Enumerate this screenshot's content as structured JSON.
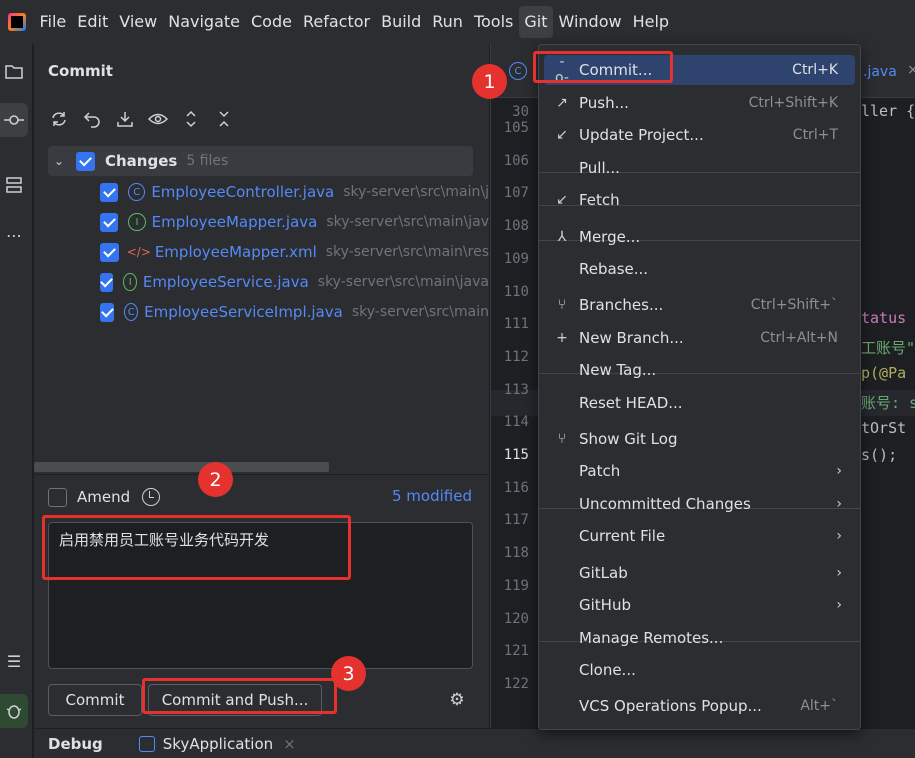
{
  "menubar": {
    "logo": "intellij-logo",
    "items": [
      "File",
      "Edit",
      "View",
      "Navigate",
      "Code",
      "Refactor",
      "Build",
      "Run",
      "Tools",
      "Git",
      "Window",
      "Help"
    ],
    "active": "Git"
  },
  "commit_panel": {
    "title": "Commit",
    "toolbar_icons": [
      "refresh-icon",
      "rollback-icon",
      "shelve-icon",
      "show-diff-icon",
      "expand-all-icon",
      "collapse-all-icon"
    ],
    "changes": {
      "label": "Changes",
      "count": "5 files"
    },
    "files": [
      {
        "icon": "C",
        "name": "EmployeeController.java",
        "path": "sky-server\\src\\main\\j"
      },
      {
        "icon": "I",
        "name": "EmployeeMapper.java",
        "path": "sky-server\\src\\main\\jav"
      },
      {
        "icon": "xml",
        "name": "EmployeeMapper.xml",
        "path": "sky-server\\src\\main\\res"
      },
      {
        "icon": "I",
        "name": "EmployeeService.java",
        "path": "sky-server\\src\\main\\java"
      },
      {
        "icon": "C",
        "name": "EmployeeServiceImpl.java",
        "path": "sky-server\\src\\main"
      }
    ],
    "amend_label": "Amend",
    "modified_link": "5 modified",
    "commit_message": "启用禁用员工账号业务代码开发",
    "commit_button": "Commit",
    "commit_push_button": "Commit and Push..."
  },
  "bottom_bar": {
    "debug_label": "Debug",
    "run_config": "SkyApplication",
    "close": "×"
  },
  "editor": {
    "tab_suffix": ".java",
    "tab_close": "×",
    "tab_icon_glyph": "C",
    "line_numbers": [
      "30",
      "105",
      "106",
      "107",
      "108",
      "109",
      "110",
      "111",
      "112",
      "113",
      "114",
      "115",
      "116",
      "117",
      "118",
      "119",
      "120",
      "121",
      "122"
    ],
    "current_line": "115",
    "code_fragments": [
      {
        "text": "ller {",
        "color": "#bcbec4"
      },
      {
        "text": "tatus",
        "color": "#c77dbb"
      },
      {
        "text": "工账号\")",
        "color": "#6aab73"
      },
      {
        "text": "p(@Pa",
        "color": "#b3ae60"
      },
      {
        "text": "账号: s",
        "color": "#6aab73"
      },
      {
        "text": "tOrSt",
        "color": "#bcbec4"
      },
      {
        "text": "s();",
        "color": "#bcbec4"
      }
    ]
  },
  "git_menu": {
    "items": [
      {
        "label": "Commit...",
        "shortcut": "Ctrl+K",
        "icon": "commit-icon",
        "glyph": "-o-",
        "selected": true
      },
      {
        "label": "Push...",
        "shortcut": "Ctrl+Shift+K",
        "icon": "push-icon",
        "glyph": "↗"
      },
      {
        "label": "Update Project...",
        "shortcut": "Ctrl+T",
        "icon": "update-icon",
        "glyph": "↙"
      },
      {
        "label": "Pull...",
        "shortcut": "",
        "icon": "",
        "glyph": ""
      },
      {
        "label": "Fetch",
        "shortcut": "",
        "icon": "fetch-icon",
        "glyph": "↙"
      },
      {
        "label": "Merge...",
        "shortcut": "",
        "icon": "merge-icon",
        "glyph": "⅄"
      },
      {
        "label": "Rebase...",
        "shortcut": "",
        "icon": "",
        "glyph": ""
      },
      {
        "label": "Branches...",
        "shortcut": "Ctrl+Shift+`",
        "icon": "branch-icon",
        "glyph": "⑂"
      },
      {
        "label": "New Branch...",
        "shortcut": "Ctrl+Alt+N",
        "icon": "plus-icon",
        "glyph": "+"
      },
      {
        "label": "New Tag...",
        "shortcut": "",
        "icon": "",
        "glyph": ""
      },
      {
        "label": "Reset HEAD...",
        "shortcut": "",
        "icon": "",
        "glyph": ""
      },
      {
        "label": "Show Git Log",
        "shortcut": "",
        "icon": "git-log-icon",
        "glyph": "⑂"
      },
      {
        "label": "Patch",
        "shortcut": "",
        "icon": "",
        "glyph": "",
        "submenu": true
      },
      {
        "label": "Uncommitted Changes",
        "shortcut": "",
        "icon": "",
        "glyph": "",
        "submenu": true
      },
      {
        "label": "Current File",
        "shortcut": "",
        "icon": "",
        "glyph": "",
        "submenu": true
      },
      {
        "label": "GitLab",
        "shortcut": "",
        "icon": "",
        "glyph": "",
        "submenu": true
      },
      {
        "label": "GitHub",
        "shortcut": "",
        "icon": "",
        "glyph": "",
        "submenu": true
      },
      {
        "label": "Manage Remotes...",
        "shortcut": "",
        "icon": "",
        "glyph": ""
      },
      {
        "label": "Clone...",
        "shortcut": "",
        "icon": "",
        "glyph": ""
      },
      {
        "label": "VCS Operations Popup...",
        "shortcut": "Alt+`",
        "icon": "",
        "glyph": ""
      }
    ]
  },
  "annotations": {
    "badges": [
      "1",
      "2",
      "3"
    ],
    "color": "#e5322e"
  },
  "colors": {
    "accent": "#3574f0",
    "link": "#548af7",
    "selection": "#2e436e",
    "panel_bg": "#2b2d30",
    "editor_bg": "#1e1f22"
  }
}
